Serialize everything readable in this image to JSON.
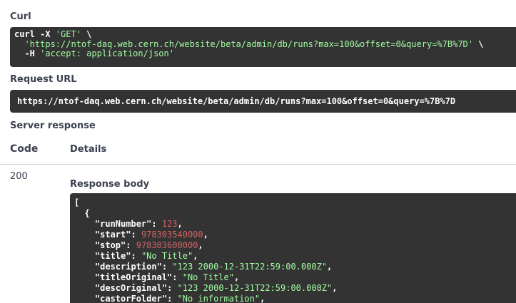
{
  "curl": {
    "heading": "Curl",
    "line1_cmd": "curl -X ",
    "line1_method": "'GET'",
    "line1_cont": " \\",
    "line2_url": "'https://ntof-daq.web.cern.ch/website/beta/admin/db/runs?max=100&offset=0&query=%7B%7D'",
    "line2_cont": " \\",
    "line3_cmd": "-H ",
    "line3_header": "'accept: application/json'"
  },
  "request_url": {
    "heading": "Request URL",
    "value": "https://ntof-daq.web.cern.ch/website/beta/admin/db/runs?max=100&offset=0&query=%7B%7D"
  },
  "server_response": {
    "heading": "Server response",
    "col_code": "Code",
    "col_details": "Details",
    "status_code": "200",
    "body_heading": "Response body"
  },
  "response_body": {
    "open_bracket": "[",
    "open_brace": "{",
    "fields": [
      {
        "key": "\"runNumber\"",
        "value": "123",
        "type": "num"
      },
      {
        "key": "\"start\"",
        "value": "978303540000",
        "type": "num"
      },
      {
        "key": "\"stop\"",
        "value": "978303600000",
        "type": "num"
      },
      {
        "key": "\"title\"",
        "value": "\"No Title\"",
        "type": "str"
      },
      {
        "key": "\"description\"",
        "value": "\"123 2000-12-31T22:59:00.000Z\"",
        "type": "str"
      },
      {
        "key": "\"titleOriginal\"",
        "value": "\"No Title\"",
        "type": "str"
      },
      {
        "key": "\"descOriginal\"",
        "value": "\"123 2000-12-31T22:59:00.000Z\"",
        "type": "str"
      },
      {
        "key": "\"castorFolder\"",
        "value": "\"No information\"",
        "type": "str"
      }
    ]
  },
  "colors": {
    "code_bg": "#333333",
    "string": "#a2fca2",
    "number": "#d36363",
    "text": "#3b4151"
  }
}
